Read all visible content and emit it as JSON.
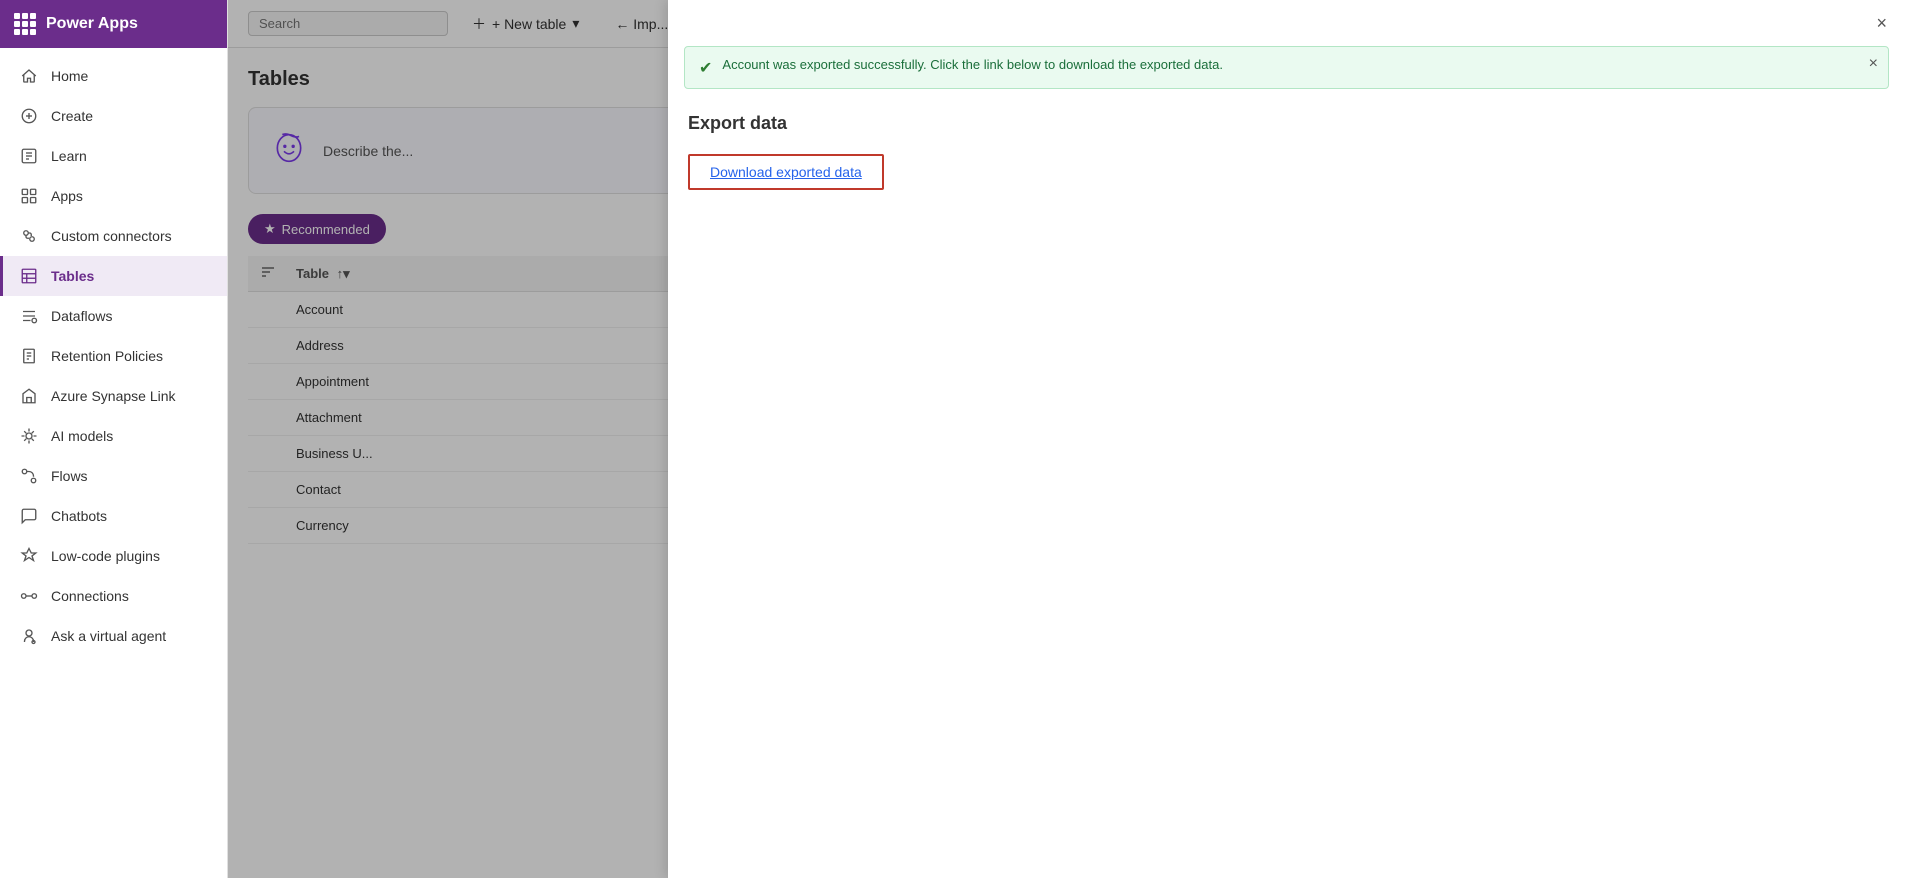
{
  "app": {
    "title": "Power Apps"
  },
  "sidebar": {
    "items": [
      {
        "id": "home",
        "label": "Home",
        "icon": "home"
      },
      {
        "id": "create",
        "label": "Create",
        "icon": "create"
      },
      {
        "id": "learn",
        "label": "Learn",
        "icon": "learn"
      },
      {
        "id": "apps",
        "label": "Apps",
        "icon": "apps"
      },
      {
        "id": "custom-connectors",
        "label": "Custom connectors",
        "icon": "custom-connectors"
      },
      {
        "id": "tables",
        "label": "Tables",
        "icon": "tables",
        "active": true
      },
      {
        "id": "dataflows",
        "label": "Dataflows",
        "icon": "dataflows"
      },
      {
        "id": "retention-policies",
        "label": "Retention Policies",
        "icon": "retention"
      },
      {
        "id": "azure-synapse",
        "label": "Azure Synapse Link",
        "icon": "azure"
      },
      {
        "id": "ai-models",
        "label": "AI models",
        "icon": "ai"
      },
      {
        "id": "flows",
        "label": "Flows",
        "icon": "flows"
      },
      {
        "id": "chatbots",
        "label": "Chatbots",
        "icon": "chatbots"
      },
      {
        "id": "low-code-plugins",
        "label": "Low-code plugins",
        "icon": "plugins"
      },
      {
        "id": "connections",
        "label": "Connections",
        "icon": "connections"
      },
      {
        "id": "ask-agent",
        "label": "Ask a virtual agent",
        "icon": "agent"
      }
    ]
  },
  "header": {
    "new_table_label": "+ New table",
    "import_label": "← Imp...",
    "search_placeholder": "Search"
  },
  "main": {
    "section_title": "Tables",
    "describe_placeholder": "Describe the...",
    "recommended_label": "Recommended",
    "table_column_label": "Table",
    "rows": [
      {
        "name": "Account"
      },
      {
        "name": "Address"
      },
      {
        "name": "Appointment"
      },
      {
        "name": "Attachment"
      },
      {
        "name": "Business U..."
      },
      {
        "name": "Contact"
      },
      {
        "name": "Currency"
      }
    ]
  },
  "modal": {
    "success_message": "Account was exported successfully. Click the link below to download the exported data.",
    "export_title": "Export data",
    "download_label": "Download exported data",
    "close_label": "×"
  }
}
